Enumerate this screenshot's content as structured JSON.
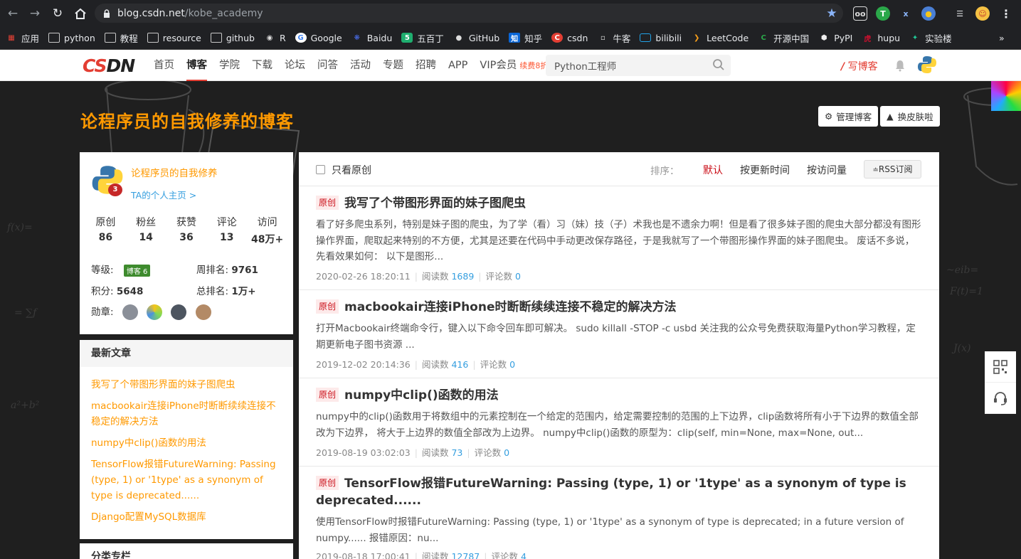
{
  "browser": {
    "url_host": "blog.csdn.net",
    "url_path": "/kobe_academy",
    "bookmarks": [
      "应用",
      "python",
      "教程",
      "resource",
      "github",
      "R",
      "Google",
      "Baidu",
      "五百丁",
      "GitHub",
      "知乎",
      "csdn",
      "牛客",
      "bilibili",
      "LeetCode",
      "开源中国",
      "PyPI",
      "hupu",
      "实验楼"
    ],
    "more_bookmarks": "»"
  },
  "nav": {
    "logo_left": "CS",
    "logo_right": "DN",
    "links": [
      "首页",
      "博客",
      "学院",
      "下载",
      "论坛",
      "问答",
      "活动",
      "专题",
      "招聘",
      "APP",
      "VIP会员"
    ],
    "vip_badge": "续费8折",
    "search_value": "Python工程师",
    "write_blog": "写博客"
  },
  "blog": {
    "title": "论程序员的自我修养的博客",
    "manage_btn": "管理博客",
    "skin_btn": "换皮肤啦"
  },
  "profile": {
    "name": "论程序员的自我修养",
    "home_link": "TA的个人主页 >",
    "stats": [
      {
        "label": "原创",
        "value": "86"
      },
      {
        "label": "粉丝",
        "value": "14"
      },
      {
        "label": "获赞",
        "value": "36"
      },
      {
        "label": "评论",
        "value": "13"
      },
      {
        "label": "访问",
        "value": "48万+"
      }
    ],
    "level_label": "等级:",
    "level_badge": "博客 6",
    "weekly_rank_label": "周排名:",
    "weekly_rank": "9761",
    "points_label": "积分:",
    "points": "5648",
    "total_rank_label": "总排名:",
    "total_rank": "1万+",
    "medals_label": "勋章:",
    "avatar_badge": "3"
  },
  "latest": {
    "heading": "最新文章",
    "items": [
      "我写了个带图形界面的妹子图爬虫",
      "macbookair连接iPhone时断断续续连接不稳定的解决方法",
      "numpy中clip()函数的用法",
      "TensorFlow报错FutureWarning: Passing (type, 1) or '1type' as a synonym of type is deprecated......",
      "Django配置MySQL数据库"
    ],
    "category_heading": "分类专栏"
  },
  "filter": {
    "only_original": "只看原创",
    "sort_label": "排序：",
    "sort_default": "默认",
    "sort_update": "按更新时间",
    "sort_views": "按访问量",
    "rss": "RSS订阅"
  },
  "articles": [
    {
      "tag": "原创",
      "title": "我写了个带图形界面的妹子图爬虫",
      "desc": "看了好多爬虫系列，特别是妹子图的爬虫，为了学（看）习（妹）技（子）术我也是不遗余力啊！但是看了很多妹子图的爬虫大部分都没有图形操作界面，爬取起来特别的不方便，尤其是还要在代码中手动更改保存路径，于是我就写了一个带图形操作界面的妹子图爬虫。 废话不多说，先看效果如何： 以下是图形...",
      "date": "2020-02-26 18:20:11",
      "views_label": "阅读数",
      "views": "1689",
      "comments_label": "评论数",
      "comments": "0"
    },
    {
      "tag": "原创",
      "title": "macbookair连接iPhone时断断续续连接不稳定的解决方法",
      "desc": "打开Macbookair终端命令行，键入以下命令回车即可解决。 sudo killall -STOP -c usbd 关注我的公众号免费获取海量Python学习教程，定期更新电子图书资源 ...",
      "date": "2019-12-02 20:14:36",
      "views_label": "阅读数",
      "views": "416",
      "comments_label": "评论数",
      "comments": "0"
    },
    {
      "tag": "原创",
      "title": "numpy中clip()函数的用法",
      "desc": "numpy中的clip()函数用于将数组中的元素控制在一个给定的范围内，给定需要控制的范围的上下边界，clip函数将所有小于下边界的数值全部改为下边界， 将大于上边界的数值全部改为上边界。 numpy中clip()函数的原型为：clip(self, min=None, max=None, out...",
      "date": "2019-08-19 03:02:03",
      "views_label": "阅读数",
      "views": "73",
      "comments_label": "评论数",
      "comments": "0"
    },
    {
      "tag": "原创",
      "title": "TensorFlow报错FutureWarning: Passing (type, 1) or '1type' as a synonym of type is deprecated......",
      "desc": "使用TensorFlow时报错FutureWarning: Passing (type, 1) or '1type' as a synonym of type is deprecated; in a future version of numpy...... 报错原因：nu...",
      "date": "2019-08-18 17:00:41",
      "views_label": "阅读数",
      "views": "12787",
      "comments_label": "评论数",
      "comments": "4"
    }
  ]
}
